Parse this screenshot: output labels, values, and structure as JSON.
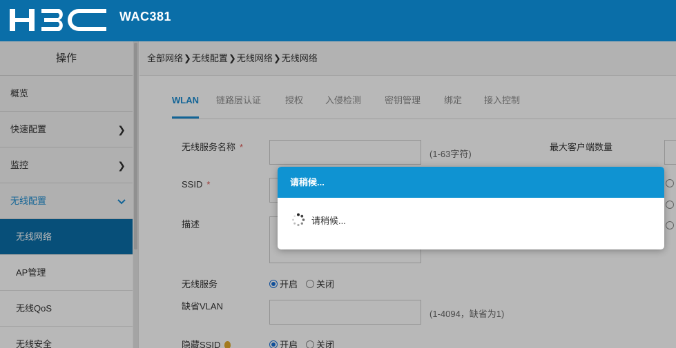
{
  "header": {
    "brand": "H3C",
    "model": "WAC381",
    "bg_color": "#0a6ea8"
  },
  "sidebar": {
    "title": "操作",
    "items": [
      {
        "label": "概览"
      },
      {
        "label": "快速配置",
        "chevron": "›"
      },
      {
        "label": "监控",
        "chevron": "›"
      },
      {
        "label": "无线配置",
        "chevron": "⌄"
      }
    ],
    "subitems": [
      {
        "label": "无线网络"
      },
      {
        "label": "AP管理"
      },
      {
        "label": "无线QoS"
      },
      {
        "label": "无线安全"
      }
    ]
  },
  "breadcrumb": {
    "items": [
      "全部网络",
      "无线配置",
      "无线网络",
      "无线网络"
    ],
    "sep": "❯"
  },
  "tabs": [
    "WLAN",
    "链路层认证",
    "授权",
    "入侵检测",
    "密钥管理",
    "绑定",
    "接入控制"
  ],
  "form": {
    "service_name_label": "无线服务名称",
    "service_name_hint": "(1-63字符)",
    "max_clients_label": "最大客户端数量",
    "ssid_label": "SSID",
    "desc_label": "描述",
    "wireless_service_label": "无线服务",
    "default_vlan_label": "缺省VLAN",
    "default_vlan_hint": "(1-4094，缺省为1)",
    "hide_ssid_label": "隐藏SSID",
    "required_mark": "*",
    "on_label": "开启",
    "off_label": "关闭"
  },
  "modal": {
    "title": "请稍候...",
    "message": "请稍候..."
  },
  "colors": {
    "accent": "#1a8bd0",
    "modal_header": "#0f93d2",
    "required": "#d9534f"
  }
}
